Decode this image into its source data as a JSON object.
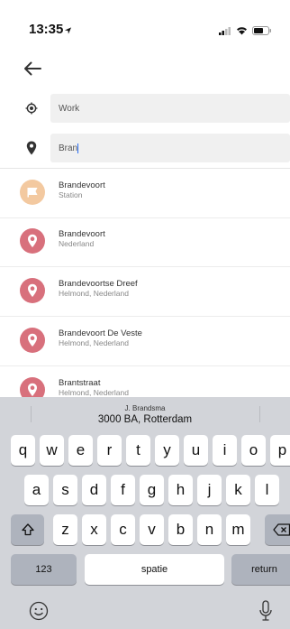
{
  "status_bar": {
    "time": "13:35"
  },
  "route": {
    "origin_value": "Work",
    "destination_value": "Bran"
  },
  "results": [
    {
      "name": "Brandevoort",
      "sub": "Station",
      "type": "station",
      "color": "#f3c9a0"
    },
    {
      "name": "Brandevoort",
      "sub": "Nederland",
      "type": "place",
      "color": "#d8707c"
    },
    {
      "name": "Brandevoortse Dreef",
      "sub": "Helmond, Nederland",
      "type": "place",
      "color": "#d8707c"
    },
    {
      "name": "Brandevoort De Veste",
      "sub": "Helmond, Nederland",
      "type": "place",
      "color": "#d8707c"
    },
    {
      "name": "Brantstraat",
      "sub": "Helmond, Nederland",
      "type": "place",
      "color": "#d8707c"
    }
  ],
  "keyboard": {
    "suggestion": {
      "line1": "J. Brandsma",
      "line2": "3000 BA, Rotterdam"
    },
    "row1": [
      "q",
      "w",
      "e",
      "r",
      "t",
      "y",
      "u",
      "i",
      "o",
      "p"
    ],
    "row2": [
      "a",
      "s",
      "d",
      "f",
      "g",
      "h",
      "j",
      "k",
      "l"
    ],
    "row3": [
      "z",
      "x",
      "c",
      "v",
      "b",
      "n",
      "m"
    ],
    "numbers_label": "123",
    "space_label": "spatie",
    "return_label": "return"
  },
  "icons": {
    "back": "arrow-left-icon",
    "origin": "location-target-icon",
    "destination": "map-pin-icon",
    "station": "flag-icon",
    "place": "pin-icon",
    "shift": "shift-arrow-icon",
    "delete": "backspace-icon",
    "emoji": "emoji-icon",
    "mic": "microphone-icon"
  }
}
